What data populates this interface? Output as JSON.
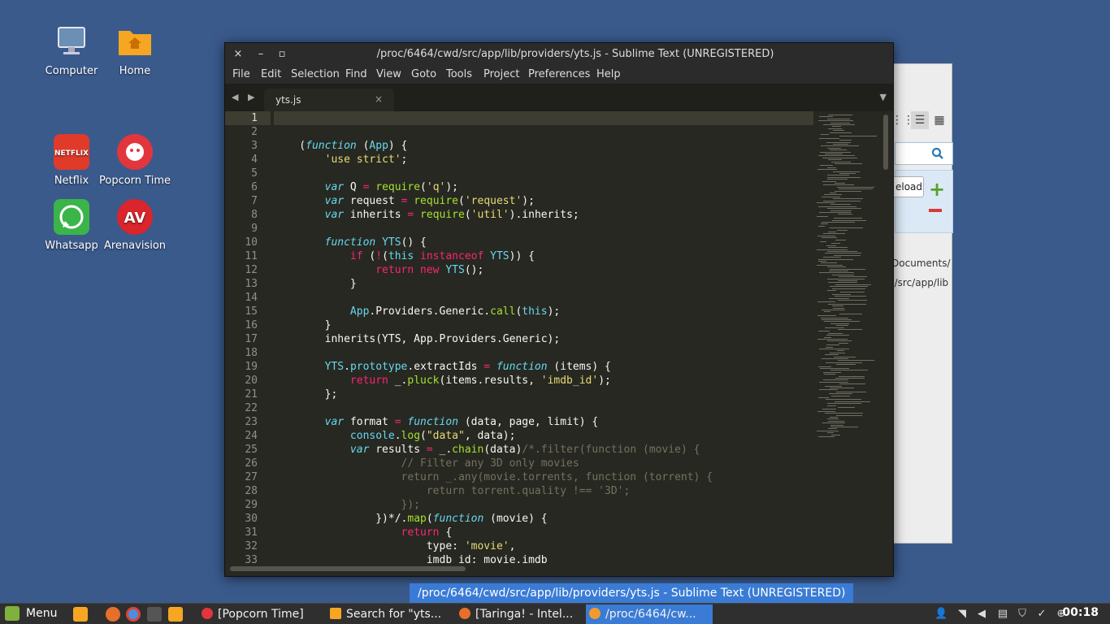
{
  "desktop": {
    "icons": [
      {
        "label": "Computer",
        "icon": "computer-icon"
      },
      {
        "label": "Home",
        "icon": "home-folder-icon"
      },
      {
        "label": "Netflix",
        "icon": "netflix-icon",
        "logo_text": "NETFLIX"
      },
      {
        "label": "Popcorn Time",
        "icon": "popcorn-time-icon"
      },
      {
        "label": "Whatsapp",
        "icon": "whatsapp-icon"
      },
      {
        "label": "Arenavision",
        "icon": "arenavision-icon",
        "logo_text": "AV"
      }
    ]
  },
  "background_window": {
    "reload_label": "eload",
    "path1": "/Documents/",
    "path2": "d/src/app/lib"
  },
  "editor": {
    "title": "/proc/6464/cwd/src/app/lib/providers/yts.js - Sublime Text (UNREGISTERED)",
    "window_buttons": {
      "close": "×",
      "minimize": "–",
      "maximize": "▫"
    },
    "menu": [
      "File",
      "Edit",
      "Selection",
      "Find",
      "View",
      "Goto",
      "Tools",
      "Project",
      "Preferences",
      "Help"
    ],
    "tab": {
      "label": "yts.js",
      "close": "×"
    },
    "nav_arrows": "◀ ▶",
    "tab_menu": "▼",
    "current_line": 1,
    "lines": [
      "",
      "",
      "    (function (App) {",
      "        'use strict';",
      "",
      "        var Q = require('q');",
      "        var request = require('request');",
      "        var inherits = require('util').inherits;",
      "",
      "        function YTS() {",
      "            if (!(this instanceof YTS)) {",
      "                return new YTS();",
      "            }",
      "",
      "            App.Providers.Generic.call(this);",
      "        }",
      "        inherits(YTS, App.Providers.Generic);",
      "",
      "        YTS.prototype.extractIds = function (items) {",
      "            return _.pluck(items.results, 'imdb_id');",
      "        };",
      "",
      "        var format = function (data, page, limit) {",
      "            console.log(\"data\", data);",
      "            var results = _.chain(data)/*.filter(function (movie) {",
      "                    // Filter any 3D only movies",
      "                    return _.any(movie.torrents, function (torrent) {",
      "                        return torrent.quality !== '3D';",
      "                    });",
      "                })*/.map(function (movie) {",
      "                    return {",
      "                        type: 'movie',",
      "                        imdb_id: movie.imdb"
    ]
  },
  "tooltip": "/proc/6464/cwd/src/app/lib/providers/yts.js - Sublime Text (UNREGISTERED)",
  "taskbar": {
    "menu_label": "Menu",
    "tasks": [
      {
        "label": "[Popcorn Time]",
        "icon": "popcorn-time-icon",
        "active": false
      },
      {
        "label": "Search for \"yts...",
        "icon": "folder-icon",
        "active": false
      },
      {
        "label": "[Taringa! - Intel...",
        "icon": "firefox-icon",
        "active": false
      },
      {
        "label": "/proc/6464/cw...",
        "icon": "sublime-icon",
        "active": true
      }
    ],
    "clock": "00:18"
  },
  "colors": {
    "desktop_bg": "#3a5a8c",
    "editor_bg": "#272822",
    "accent": "#3a7bd5",
    "keyword": "#f92672",
    "string": "#e6db74",
    "function": "#a6e22e",
    "storage": "#66d9ef",
    "parameter": "#fd971f",
    "comment": "#75715e"
  }
}
